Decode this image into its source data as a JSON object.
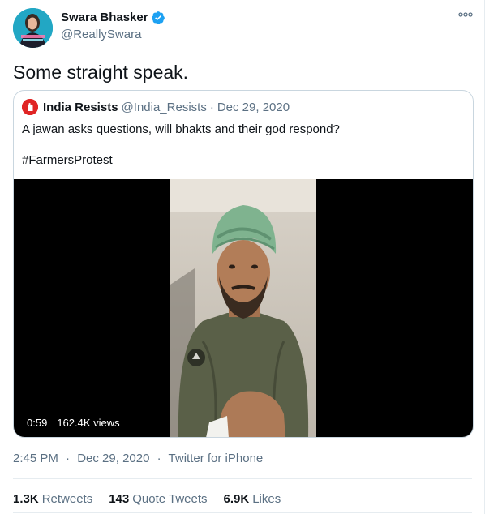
{
  "author": {
    "name": "Swara Bhasker",
    "handle": "@ReallySwara"
  },
  "tweet": {
    "text": "Some straight speak.",
    "time": "2:45 PM",
    "date": "Dec 29, 2020",
    "source": "Twitter for iPhone",
    "separator": "·"
  },
  "quoted": {
    "name": "India Resists",
    "handle": "@India_Resists",
    "separator": "·",
    "date": "Dec 29, 2020",
    "text": "A jawan asks questions, will bhakts and their god respond?",
    "hashtag": "#FarmersProtest",
    "video": {
      "duration": "0:59",
      "views": "162.4K views"
    }
  },
  "stats": {
    "retweets_count": "1.3K",
    "retweets_label": "Retweets",
    "quotes_count": "143",
    "quotes_label": "Quote Tweets",
    "likes_count": "6.9K",
    "likes_label": "Likes"
  },
  "colors": {
    "verified": "#1da1f2",
    "muted": "#5b7083",
    "text": "#0f1419",
    "logo": "#e02424",
    "avatar_bg": "#22a7c4"
  },
  "icons": [
    "verified-badge-icon",
    "more-options-icon",
    "india-resists-logo-icon"
  ]
}
